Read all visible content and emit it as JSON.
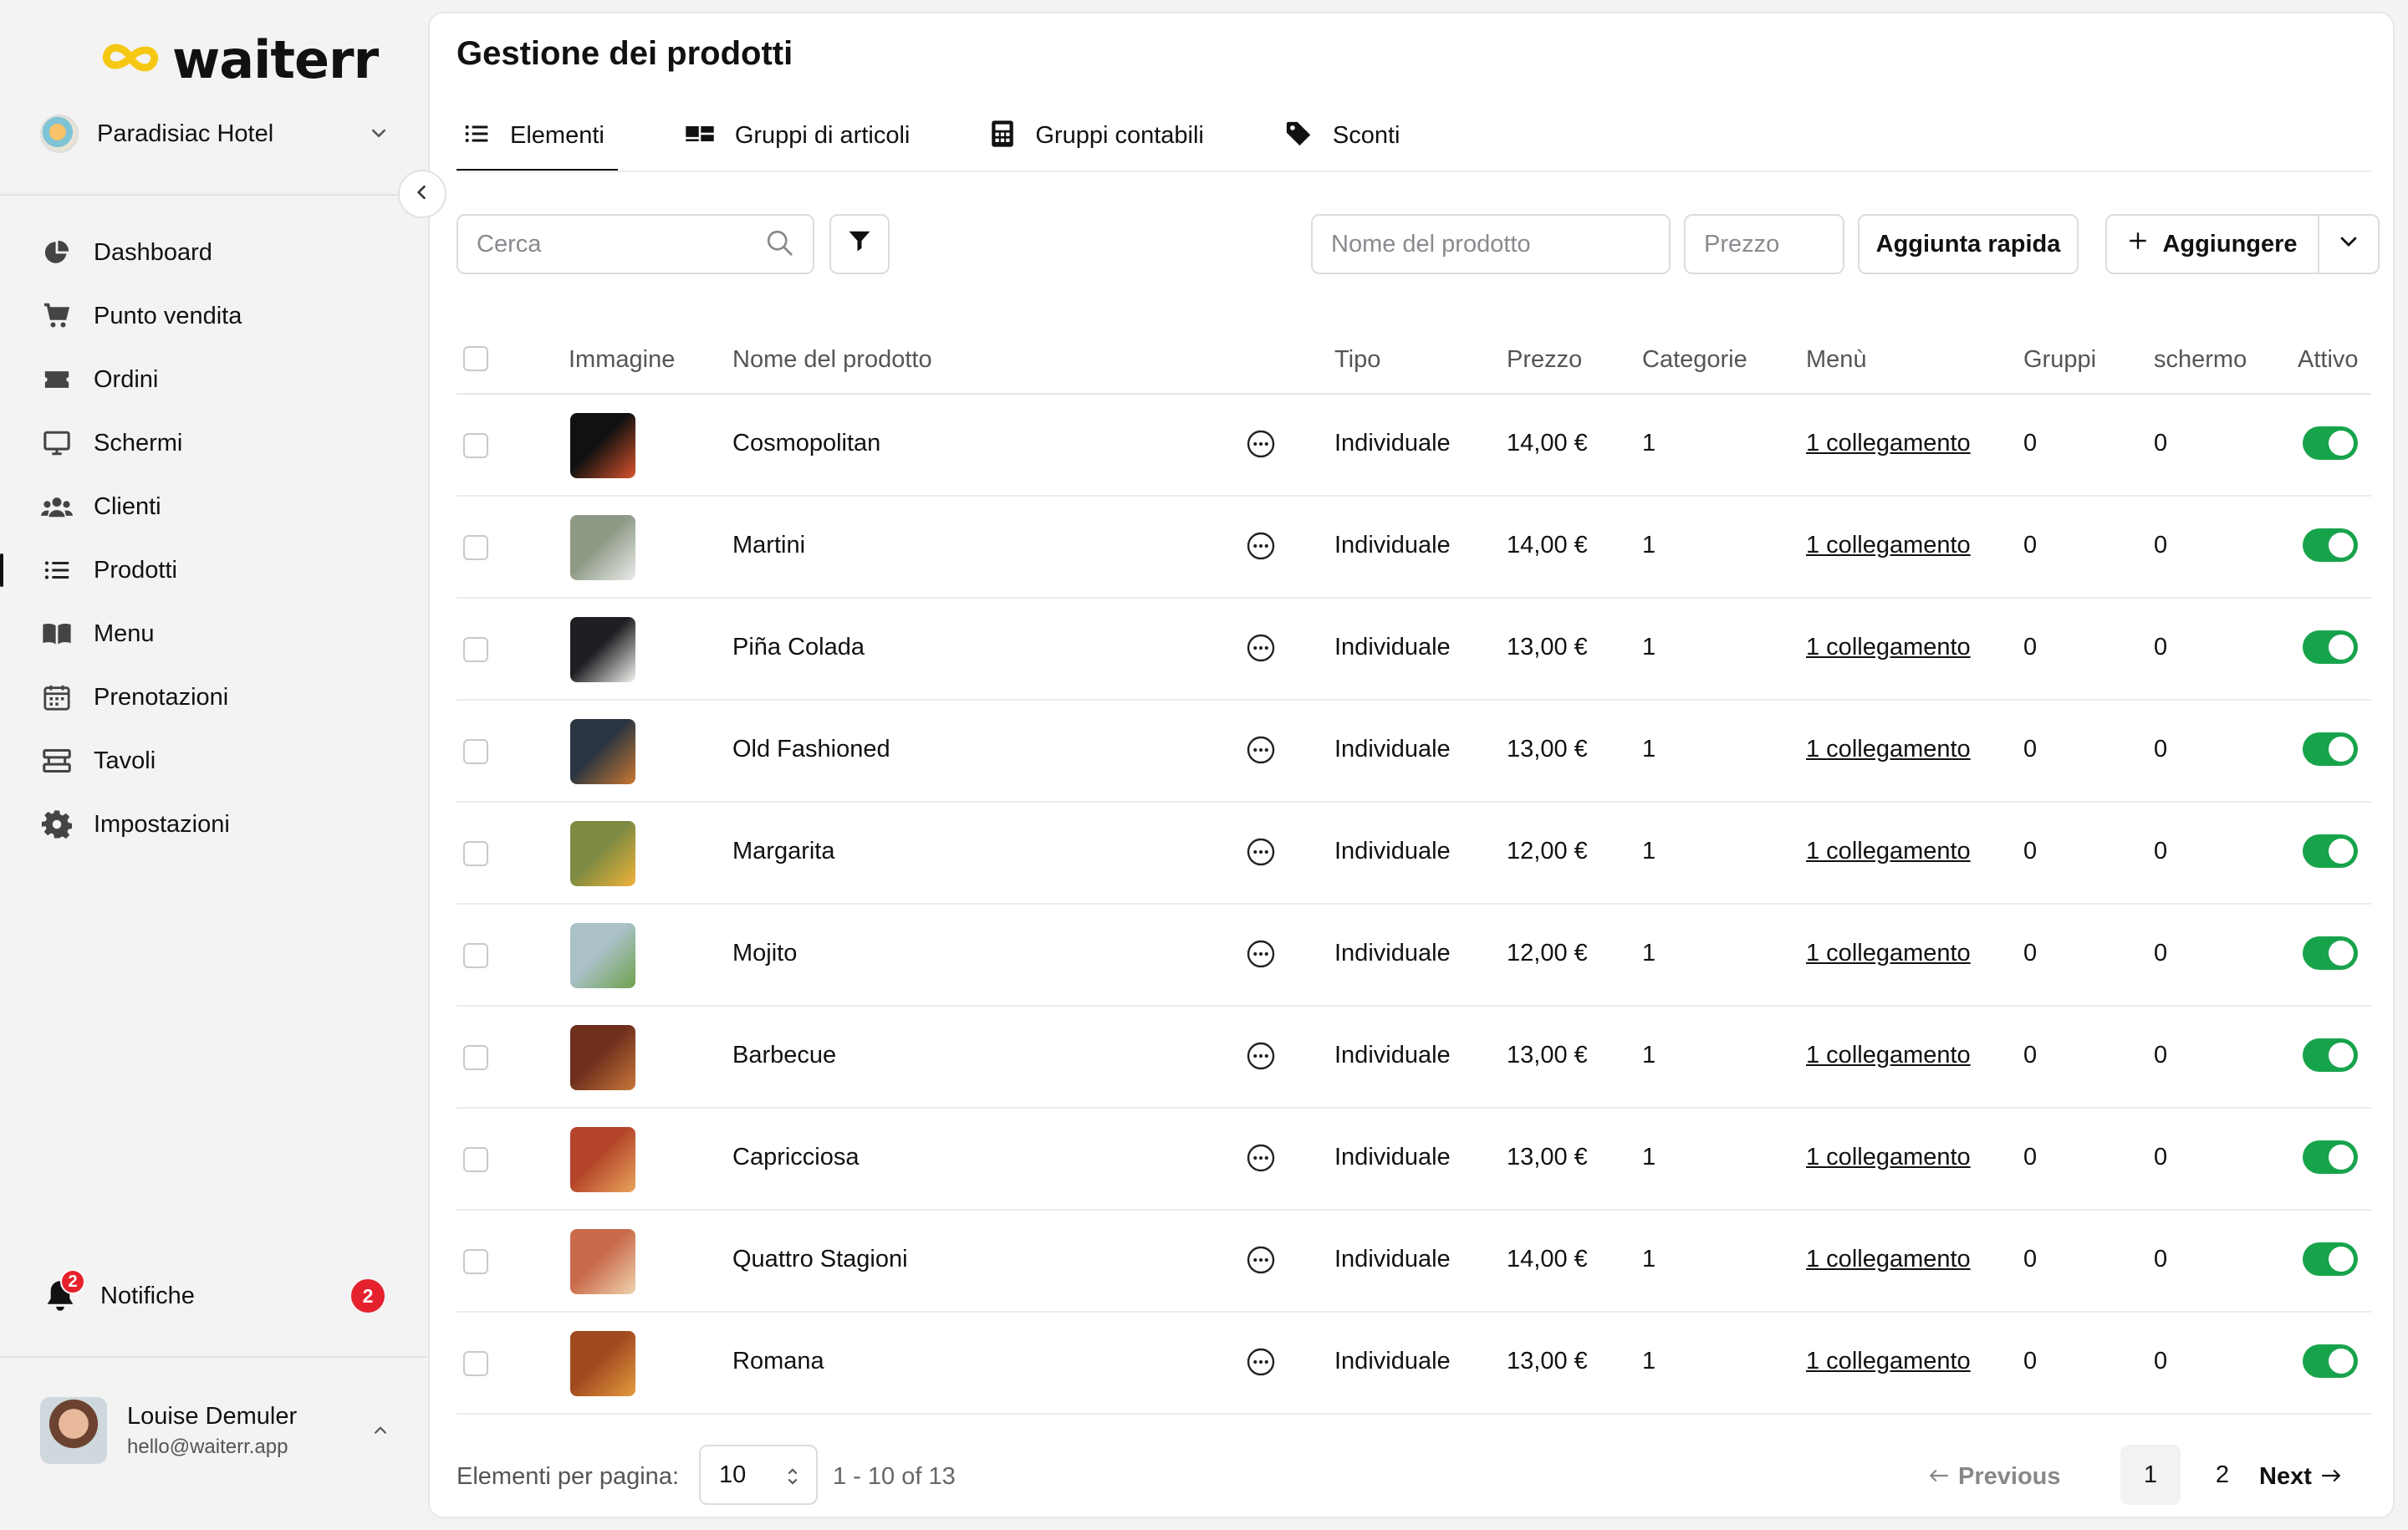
{
  "app": {
    "logo_text": "waiterr",
    "brand_color": "#f6c814",
    "accent_green": "#17a34a",
    "badge_red": "#e5212e"
  },
  "sidebar": {
    "venue": "Paradisiac Hotel",
    "items": [
      {
        "label": "Dashboard",
        "icon": "pie-chart-icon"
      },
      {
        "label": "Punto vendita",
        "icon": "cart-icon"
      },
      {
        "label": "Ordini",
        "icon": "ticket-icon"
      },
      {
        "label": "Schermi",
        "icon": "monitor-icon"
      },
      {
        "label": "Clienti",
        "icon": "users-icon"
      },
      {
        "label": "Prodotti",
        "icon": "list-icon",
        "active": true
      },
      {
        "label": "Menu",
        "icon": "book-icon"
      },
      {
        "label": "Prenotazioni",
        "icon": "calendar-icon"
      },
      {
        "label": "Tavoli",
        "icon": "table-icon"
      },
      {
        "label": "Impostazioni",
        "icon": "gear-icon"
      }
    ],
    "notifications": {
      "label": "Notifiche",
      "count": "2"
    },
    "user": {
      "name": "Louise Demuler",
      "email": "hello@waiterr.app"
    }
  },
  "main": {
    "title": "Gestione dei prodotti",
    "tabs": [
      {
        "label": "Elementi",
        "icon": "list-icon",
        "active": true
      },
      {
        "label": "Gruppi di articoli",
        "icon": "groups-icon"
      },
      {
        "label": "Gruppi contabili",
        "icon": "calculator-icon"
      },
      {
        "label": "Sconti",
        "icon": "tag-icon"
      }
    ],
    "toolbar": {
      "search_placeholder": "Cerca",
      "name_placeholder": "Nome del prodotto",
      "price_placeholder": "Prezzo",
      "quick_add_label": "Aggiunta rapida",
      "add_label": "Aggiungere"
    },
    "table": {
      "columns": [
        "Immagine",
        "Nome del prodotto",
        "Tipo",
        "Prezzo",
        "Categorie",
        "Menù",
        "Gruppi",
        "schermo",
        "Attivo"
      ],
      "rows": [
        {
          "name": "Cosmopolitan",
          "type": "Individuale",
          "price": "14,00 €",
          "categories": "1",
          "menu": "1 collegamento",
          "groups": "0",
          "screen": "0",
          "active": true,
          "colors": [
            "#111111",
            "#d9532c"
          ]
        },
        {
          "name": "Martini",
          "type": "Individuale",
          "price": "14,00 €",
          "categories": "1",
          "menu": "1 collegamento",
          "groups": "0",
          "screen": "0",
          "active": true,
          "colors": [
            "#8f9a86",
            "#e9ecea"
          ]
        },
        {
          "name": "Piña Colada",
          "type": "Individuale",
          "price": "13,00 €",
          "categories": "1",
          "menu": "1 collegamento",
          "groups": "0",
          "screen": "0",
          "active": true,
          "colors": [
            "#1d1f22",
            "#f4f4f0"
          ]
        },
        {
          "name": "Old Fashioned",
          "type": "Individuale",
          "price": "13,00 €",
          "categories": "1",
          "menu": "1 collegamento",
          "groups": "0",
          "screen": "0",
          "active": true,
          "colors": [
            "#2b3542",
            "#c9782f"
          ]
        },
        {
          "name": "Margarita",
          "type": "Individuale",
          "price": "12,00 €",
          "categories": "1",
          "menu": "1 collegamento",
          "groups": "0",
          "screen": "0",
          "active": true,
          "colors": [
            "#7c8a42",
            "#f0b23a"
          ]
        },
        {
          "name": "Mojito",
          "type": "Individuale",
          "price": "12,00 €",
          "categories": "1",
          "menu": "1 collegamento",
          "groups": "0",
          "screen": "0",
          "active": true,
          "colors": [
            "#a9c1c7",
            "#6fa14d"
          ]
        },
        {
          "name": "Barbecue",
          "type": "Individuale",
          "price": "13,00 €",
          "categories": "1",
          "menu": "1 collegamento",
          "groups": "0",
          "screen": "0",
          "active": true,
          "colors": [
            "#6e2f1c",
            "#c9773a"
          ]
        },
        {
          "name": "Capricciosa",
          "type": "Individuale",
          "price": "13,00 €",
          "categories": "1",
          "menu": "1 collegamento",
          "groups": "0",
          "screen": "0",
          "active": true,
          "colors": [
            "#b5452a",
            "#e7a65c"
          ]
        },
        {
          "name": "Quattro Stagioni",
          "type": "Individuale",
          "price": "14,00 €",
          "categories": "1",
          "menu": "1 collegamento",
          "groups": "0",
          "screen": "0",
          "active": true,
          "colors": [
            "#c96b4b",
            "#efd4b0"
          ]
        },
        {
          "name": "Romana",
          "type": "Individuale",
          "price": "13,00 €",
          "categories": "1",
          "menu": "1 collegamento",
          "groups": "0",
          "screen": "0",
          "active": true,
          "colors": [
            "#a14a1f",
            "#e49a3e"
          ]
        }
      ]
    },
    "pagination": {
      "per_page_label": "Elementi per pagina:",
      "per_page": "10",
      "range": "1 - 10 of 13",
      "prev": "Previous",
      "pages": [
        "1",
        "2"
      ],
      "current_page": "1",
      "next": "Next"
    }
  }
}
